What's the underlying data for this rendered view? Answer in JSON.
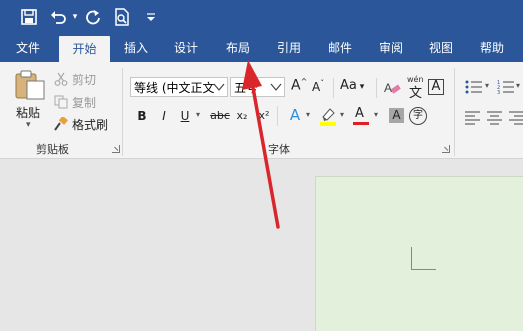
{
  "qat": {
    "save_icon": "save-icon",
    "undo_icon": "undo-icon",
    "redo_icon": "redo-icon",
    "preview_icon": "print-preview-icon",
    "customize_icon": "customize-qat-icon"
  },
  "tabs": [
    "文件",
    "开始",
    "插入",
    "设计",
    "布局",
    "引用",
    "邮件",
    "审阅",
    "视图",
    "帮助"
  ],
  "active_tab": "开始",
  "clipboard": {
    "paste": "粘贴",
    "cut": "剪切",
    "copy": "复制",
    "format_painter": "格式刷",
    "group_label": "剪贴板"
  },
  "font": {
    "font_name": "等线 (中文正文",
    "font_size": "五号",
    "grow": "A",
    "shrink": "A",
    "change_case": "Aa",
    "clear_format_icon": "clear-formatting-icon",
    "phonetic": "文",
    "bold": "B",
    "italic": "I",
    "underline": "U",
    "strikethrough": "abc",
    "subscript": "x₂",
    "superscript": "x²",
    "text_effects": "A",
    "highlight_icon": "highlighter-icon",
    "font_color": "A",
    "char_shading": "A",
    "enclose_char": "字",
    "group_label": "字体"
  },
  "colors": {
    "title_blue": "#2b579a",
    "highlight_yellow": "#ffff00",
    "font_red": "#e02020",
    "arrow_red": "#d9262b",
    "page_green": "#e3f0db"
  }
}
